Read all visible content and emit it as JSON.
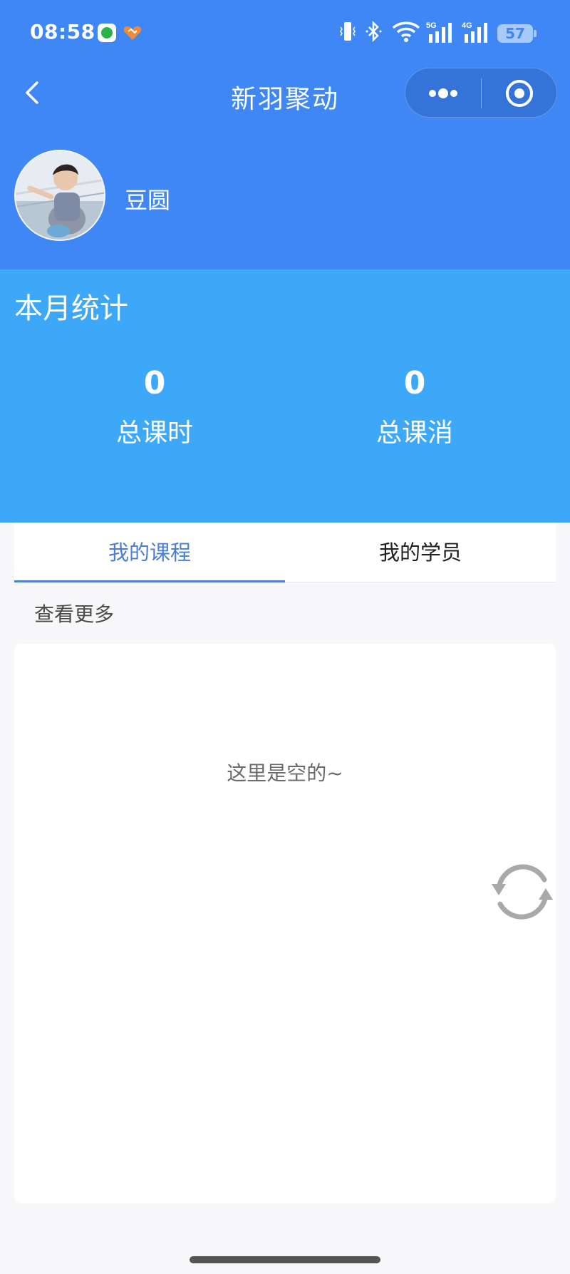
{
  "status_bar": {
    "time": "08:58",
    "network_a": "5G",
    "network_b": "4G",
    "battery": "57"
  },
  "navbar": {
    "title": "新羽聚动"
  },
  "profile": {
    "name": "豆圆"
  },
  "stats": {
    "title": "本月统计",
    "items": [
      {
        "value": "0",
        "label": "总课时"
      },
      {
        "value": "0",
        "label": "总课消"
      }
    ]
  },
  "tabs": [
    {
      "label": "我的课程",
      "active": true
    },
    {
      "label": "我的学员",
      "active": false
    }
  ],
  "see_more": "查看更多",
  "empty_state": "这里是空的~",
  "colors": {
    "header": "#3e87f5",
    "stats_bg": "#3ea8f8",
    "tab_active": "#4a7fd6"
  }
}
